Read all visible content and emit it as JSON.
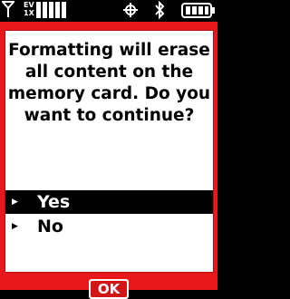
{
  "statusbar": {
    "network_label_top": "EV",
    "network_label_bottom": "1X",
    "icons": [
      "signal-strength-icon",
      "network-type-icon",
      "location-icon",
      "bluetooth-icon",
      "battery-icon"
    ]
  },
  "dialog": {
    "message": "Formatting will erase all content on the memory card. Do you want to continue?",
    "options": [
      {
        "label": "Yes",
        "selected": true
      },
      {
        "label": "No",
        "selected": false
      }
    ],
    "ok_label": "OK"
  },
  "colors": {
    "dialog_background": "#e8191d",
    "softkey_background": "#d11516",
    "selection": "#000000"
  }
}
